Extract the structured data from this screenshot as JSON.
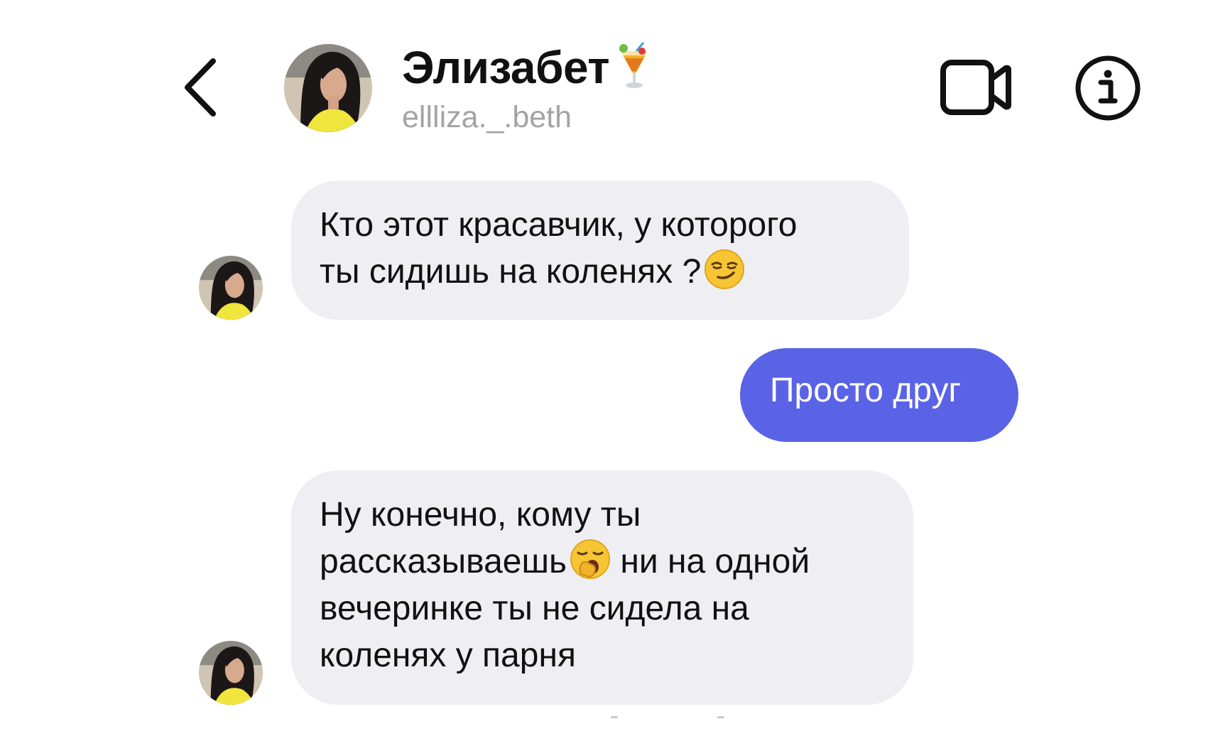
{
  "header": {
    "back_icon": "chevron-left-icon",
    "contact_name": "Элизабет",
    "name_emoji": "tropical-drink-emoji",
    "username": "ellliza._.beth",
    "video_icon": "video-camera-icon",
    "info_icon": "info-icon"
  },
  "messages": [
    {
      "direction": "incoming",
      "lines": [
        "Кто этот красавчик, у которого",
        "ты сидишь на коленях ?"
      ],
      "emoji": "smirking-face-emoji"
    },
    {
      "direction": "outgoing",
      "lines": [
        "Просто друг"
      ]
    },
    {
      "direction": "incoming",
      "lines": [
        "Ну конечно, кому ты",
        "рассказываешь",
        "ни на одной",
        "вечеринке ты не сидела на",
        "коленях у парня"
      ],
      "emoji": "yawning-face-emoji"
    }
  ],
  "colors": {
    "incoming_bubble": "#efeef2",
    "outgoing_bubble": "#5a63e6",
    "username_text": "#a3a3a3"
  }
}
